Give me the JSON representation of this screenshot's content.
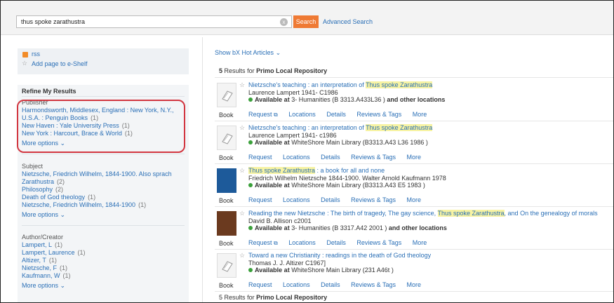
{
  "search": {
    "query": "thus spoke zarathustra",
    "clear_label": "x",
    "button_label": "Search",
    "advanced_label": "Advanced Search"
  },
  "left": {
    "rss_label": "rss",
    "eshelf_label": "Add page to e-Shelf",
    "refine_title": "Refine My Results",
    "publisher": {
      "title": "Publisher",
      "items": [
        {
          "label": "Harmondsworth, Middlesex, England : New York, N.Y.,",
          "count": ""
        },
        {
          "label": "U.S.A. : Penguin Books",
          "count": "(1)"
        },
        {
          "label": "New Haven : Yale University Press",
          "count": "(1)"
        },
        {
          "label": "New York : Harcourt, Brace & World",
          "count": "(1)"
        }
      ],
      "more": "More options"
    },
    "subject": {
      "title": "Subject",
      "items": [
        {
          "label": "Nietzsche, Friedrich Wilhelm, 1844-1900. Also sprach",
          "count": ""
        },
        {
          "label": "Zarathustra",
          "count": "(2)"
        },
        {
          "label": "Philosophy",
          "count": "(2)"
        },
        {
          "label": "Death of God theology",
          "count": "(1)"
        },
        {
          "label": "Nietzsche, Friedrich Wilhelm, 1844-1900",
          "count": "(1)"
        }
      ],
      "more": "More options"
    },
    "author": {
      "title": "Author/Creator",
      "items": [
        {
          "label": "Lampert, L",
          "count": "(1)"
        },
        {
          "label": "Lampert, Laurence",
          "count": "(1)"
        },
        {
          "label": "Altizer, T",
          "count": "(1)"
        },
        {
          "label": "Nietzsche, F",
          "count": "(1)"
        },
        {
          "label": "Kaufmann, W",
          "count": "(1)"
        }
      ],
      "more": "More options"
    }
  },
  "right": {
    "hot_articles": "Show bX Hot Articles",
    "results_count": "5",
    "results_text": "Results",
    "results_for": "for",
    "repository": "Primo Local Repository",
    "results": [
      {
        "title_pre": "Nietzsche's teaching : an interpretation of ",
        "title_hl": "Thus spoke Zarathustra",
        "title_post": "",
        "author": "Laurence Lampert 1941- C1986",
        "avail_label": "Available at",
        "avail_loc": "3- Humanities",
        "avail_call": "(B 3313.A433L36 )",
        "avail_extra": "and other locations",
        "type": "Book",
        "tabs": [
          "Request",
          "Locations",
          "Details",
          "Reviews & Tags",
          "More"
        ]
      },
      {
        "title_pre": "Nietzsche's teaching : an interpretation of ",
        "title_hl": "Thus spoke Zarathustra",
        "title_post": "",
        "author": "Laurence Lampert 1941- c1986",
        "avail_label": "Available at",
        "avail_loc": "WhiteShore Main Library",
        "avail_call": "(B3313.A43 L36 1986 )",
        "avail_extra": "",
        "type": "Book",
        "tabs": [
          "Request",
          "Locations",
          "Details",
          "Reviews & Tags",
          "More"
        ]
      },
      {
        "title_pre": "",
        "title_hl": "Thus spoke Zarathustra",
        "title_post": " : a book for all and none",
        "author": "Friedrich Wilhelm Nietzsche 1844-1900. Walter Arnold Kaufmann 1978",
        "avail_label": "Available at",
        "avail_loc": "WhiteShore Main Library",
        "avail_call": "(B3313.A43 E5 1983 )",
        "avail_extra": "",
        "type": "Book",
        "tabs": [
          "Request",
          "Locations",
          "Details",
          "Reviews & Tags",
          "More"
        ]
      },
      {
        "title_pre": "Reading the new Nietzsche : The birth of tragedy, The gay science, ",
        "title_hl": "Thus spoke Zarathustra",
        "title_post": ", and On the genealogy of morals",
        "author": "David B. Allison c2001",
        "avail_label": "Available at",
        "avail_loc": "3- Humanities",
        "avail_call": "(B 3317.A42 2001 )",
        "avail_extra": "and other locations",
        "type": "Book",
        "tabs": [
          "Request",
          "Locations",
          "Details",
          "Reviews & Tags",
          "More"
        ]
      },
      {
        "title_pre": "Toward a new Christianity : readings in the death of God theology",
        "title_hl": "",
        "title_post": "",
        "author": "Thomas J. J. Altizer C1967]",
        "avail_label": "Available at",
        "avail_loc": "WhiteShore Main Library",
        "avail_call": "(231 A46t )",
        "avail_extra": "",
        "type": "Book",
        "tabs": [
          "Request",
          "Locations",
          "Details",
          "Reviews & Tags",
          "More"
        ]
      }
    ]
  }
}
